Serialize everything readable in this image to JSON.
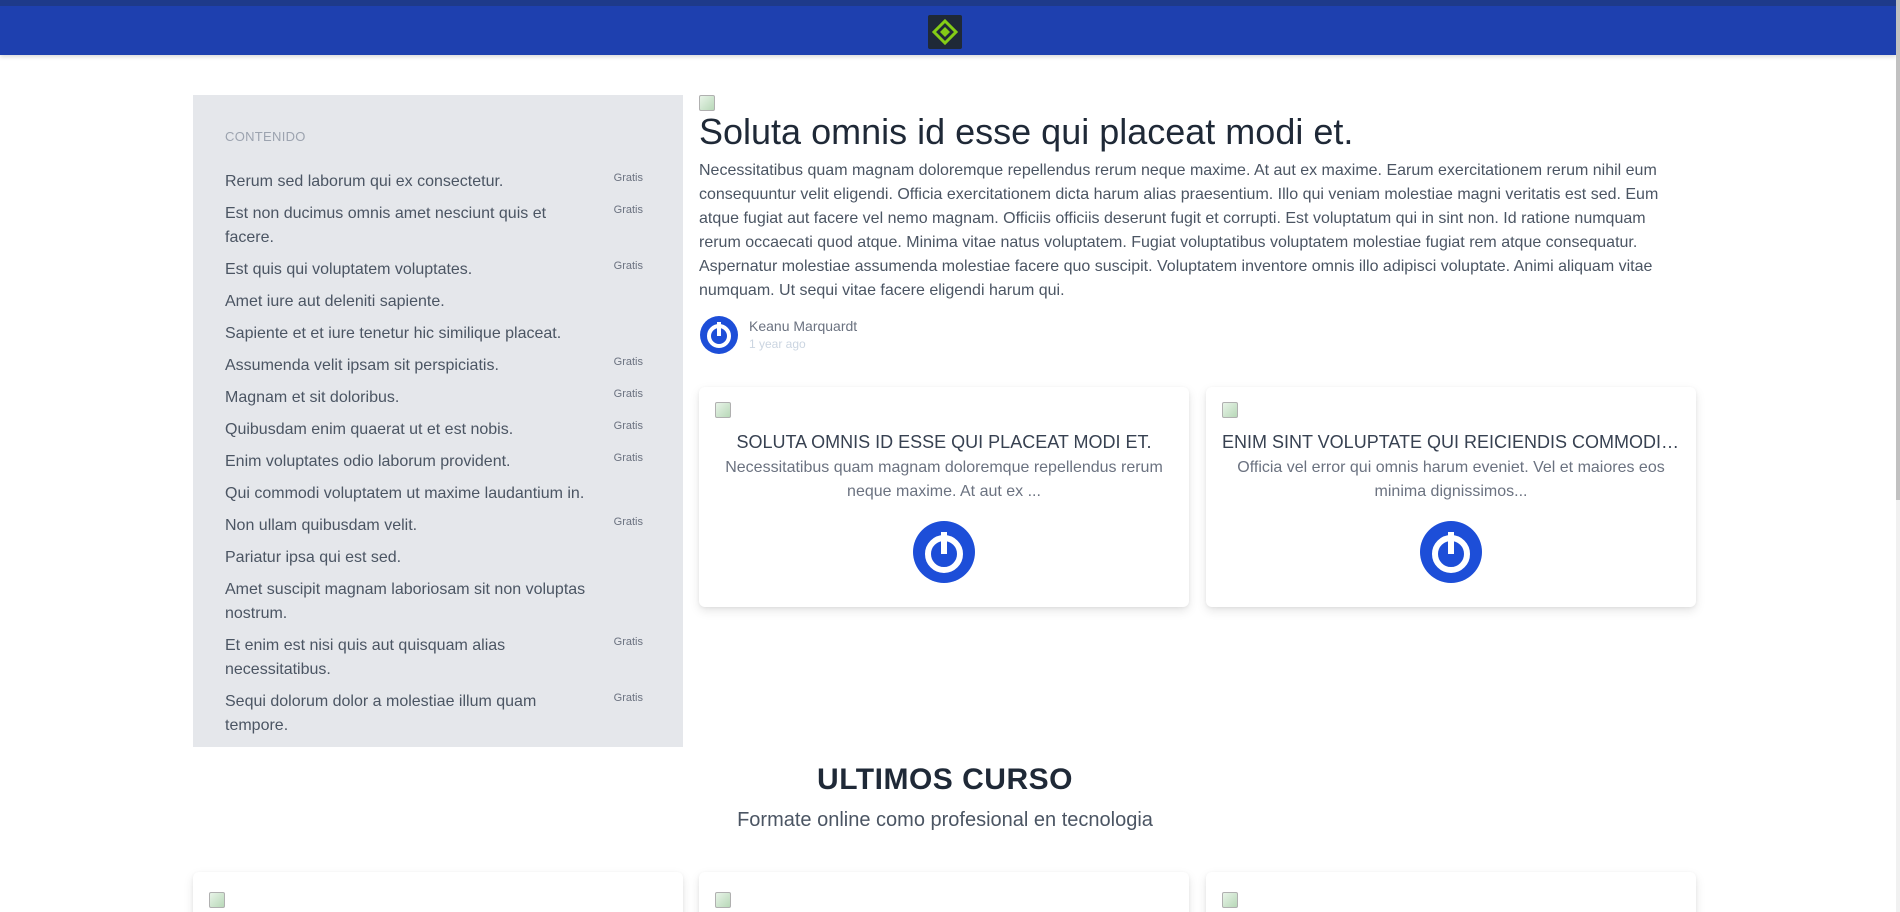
{
  "colors": {
    "navbar": "#1e40af",
    "accent": "#1d4ed8",
    "sidebar_bg": "#e5e7eb"
  },
  "navbar": {
    "logo_icon": "logo-icon"
  },
  "sidebar": {
    "heading": "CONTENIDO",
    "lessons": [
      {
        "title": "Rerum sed laborum qui ex consectetur.",
        "badge": "Gratis"
      },
      {
        "title": "Est non ducimus omnis amet nesciunt quis et facere.",
        "badge": "Gratis"
      },
      {
        "title": "Est quis qui voluptatem voluptates.",
        "badge": "Gratis"
      },
      {
        "title": "Amet iure aut deleniti sapiente.",
        "badge": ""
      },
      {
        "title": "Sapiente et et iure tenetur hic similique placeat.",
        "badge": ""
      },
      {
        "title": "Assumenda velit ipsam sit perspiciatis.",
        "badge": "Gratis"
      },
      {
        "title": "Magnam et sit doloribus.",
        "badge": "Gratis"
      },
      {
        "title": "Quibusdam enim quaerat ut et est nobis.",
        "badge": "Gratis"
      },
      {
        "title": "Enim voluptates odio laborum provident.",
        "badge": "Gratis"
      },
      {
        "title": "Qui commodi voluptatem ut maxime laudantium in.",
        "badge": ""
      },
      {
        "title": "Non ullam quibusdam velit.",
        "badge": "Gratis"
      },
      {
        "title": "Pariatur ipsa qui est sed.",
        "badge": ""
      },
      {
        "title": "Amet suscipit magnam laboriosam sit non voluptas nostrum.",
        "badge": ""
      },
      {
        "title": "Et enim est nisi quis aut quisquam alias necessitatibus.",
        "badge": "Gratis"
      },
      {
        "title": "Sequi dolorum dolor a molestiae illum quam tempore.",
        "badge": "Gratis"
      }
    ]
  },
  "article": {
    "title": "Soluta omnis id esse qui placeat modi et.",
    "body": "Necessitatibus quam magnam doloremque repellendus rerum neque maxime. At aut ex maxime. Earum exercitationem rerum nihil eum consequuntur velit eligendi. Officia exercitationem dicta harum alias praesentium. Illo qui veniam molestiae magni veritatis est sed. Eum atque fugiat aut facere vel nemo magnam. Officiis officiis deserunt fugit et corrupti. Est voluptatum qui in sint non. Id ratione numquam rerum occaecati quod atque. Minima vitae natus voluptatem. Fugiat voluptatibus voluptatem molestiae fugiat rem atque consequatur. Aspernatur molestiae assumenda molestiae facere quo suscipit. Voluptatem inventore omnis illo adipisci voluptate. Animi aliquam vitae numquam. Ut sequi vitae facere eligendi harum qui.",
    "author": {
      "name": "Keanu Marquardt",
      "time": "1 year ago"
    }
  },
  "related": [
    {
      "title": "SOLUTA OMNIS ID ESSE QUI PLACEAT MODI ET.",
      "desc": "Necessitatibus quam magnam doloremque repellendus rerum neque maxime. At aut ex ..."
    },
    {
      "title": "ENIM SINT VOLUPTATE QUI REICIENDIS COMMODI NAT...",
      "desc": "Officia vel error qui omnis harum eveniet. Vel et maiores eos minima dignissimos..."
    }
  ],
  "section": {
    "title": "ULTIMOS CURSO",
    "subtitle": "Formate online como profesional en tecnologia"
  }
}
